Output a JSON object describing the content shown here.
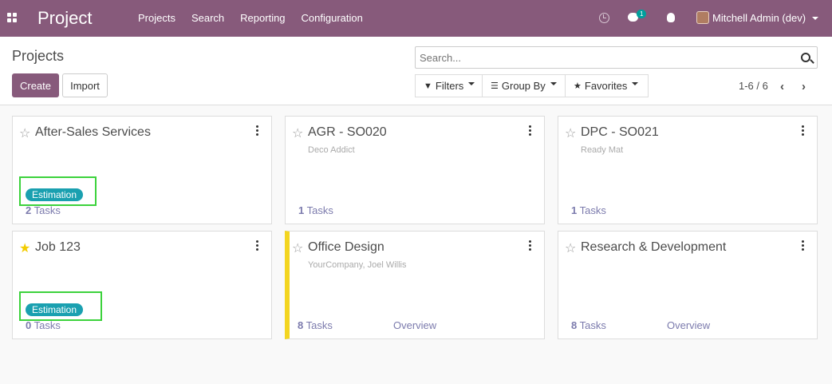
{
  "navbar": {
    "app_title": "Project",
    "menu": [
      "Projects",
      "Search",
      "Reporting",
      "Configuration"
    ],
    "chat_badge": "1",
    "user_name": "Mitchell Admin (dev)",
    "color": "#875a7b"
  },
  "control_panel": {
    "breadcrumb": "Projects",
    "create_label": "Create",
    "import_label": "Import",
    "search_placeholder": "Search...",
    "filters_label": "Filters",
    "group_by_label": "Group By",
    "favorites_label": "Favorites",
    "pager": "1-6 / 6"
  },
  "projects": [
    {
      "name": "After-Sales Services",
      "subtitle": "",
      "favorite": false,
      "tag": "Estimation",
      "task_count": "2",
      "tasks_label": "Tasks",
      "overview": ""
    },
    {
      "name": "AGR - SO020",
      "subtitle": "Deco Addict",
      "favorite": false,
      "tag": "",
      "task_count": "1",
      "tasks_label": "Tasks",
      "overview": ""
    },
    {
      "name": "DPC - SO021",
      "subtitle": "Ready Mat",
      "favorite": false,
      "tag": "",
      "task_count": "1",
      "tasks_label": "Tasks",
      "overview": ""
    },
    {
      "name": "Job 123",
      "subtitle": "",
      "favorite": true,
      "tag": "Estimation",
      "task_count": "0",
      "tasks_label": "Tasks",
      "overview": ""
    },
    {
      "name": "Office Design",
      "subtitle": "YourCompany, Joel Willis",
      "favorite": false,
      "tag": "",
      "task_count": "8",
      "tasks_label": "Tasks",
      "overview": "Overview",
      "color_bar": "#f3d520"
    },
    {
      "name": "Research & Development",
      "subtitle": "",
      "favorite": false,
      "tag": "",
      "task_count": "8",
      "tasks_label": "Tasks",
      "overview": "Overview"
    }
  ],
  "icons": {
    "star_empty": "☆",
    "star_filled": "★",
    "filter": "▼",
    "group_by": "☰",
    "favorites": "★",
    "pager_prev": "‹",
    "pager_next": "›"
  }
}
